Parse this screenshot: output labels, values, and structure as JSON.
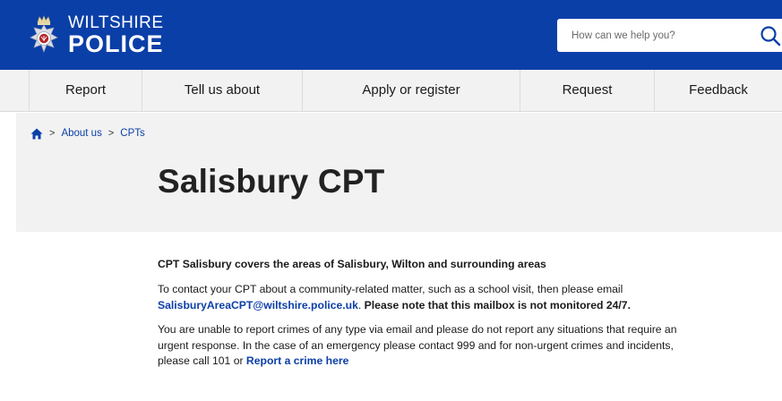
{
  "header": {
    "brand_top": "WILTSHIRE",
    "brand_bottom": "POLICE",
    "search_placeholder": "How can we help you?",
    "logo_icon": "police-crest-icon",
    "search_icon": "search-icon",
    "colors": {
      "header_bg": "#0b3fa8",
      "text": "#ffffff"
    }
  },
  "nav": {
    "items": [
      "Report",
      "Tell us about",
      "Apply or register",
      "Request",
      "Feedback"
    ]
  },
  "breadcrumb": {
    "home_icon": "home-icon",
    "separator": ">",
    "items": [
      "About us",
      "CPTs"
    ]
  },
  "page": {
    "title": "Salisbury CPT"
  },
  "content": {
    "lead": "CPT Salisbury covers the areas of Salisbury, Wilton and surrounding areas",
    "p1_before": "To contact your CPT about a community-related matter, such as a school visit, then please email ",
    "p1_email": "SalisburyAreaCPT@wiltshire.police.uk",
    "p1_after": ". ",
    "p1_bold": "Please note that this mailbox is not monitored 24/7.",
    "p2_text": "You are unable to report crimes of any type via email and please do not report any situations that require an urgent response. In the case of an emergency please contact 999 and for non-urgent crimes and incidents, please call 101 or ",
    "p2_link": "Report a crime here"
  }
}
